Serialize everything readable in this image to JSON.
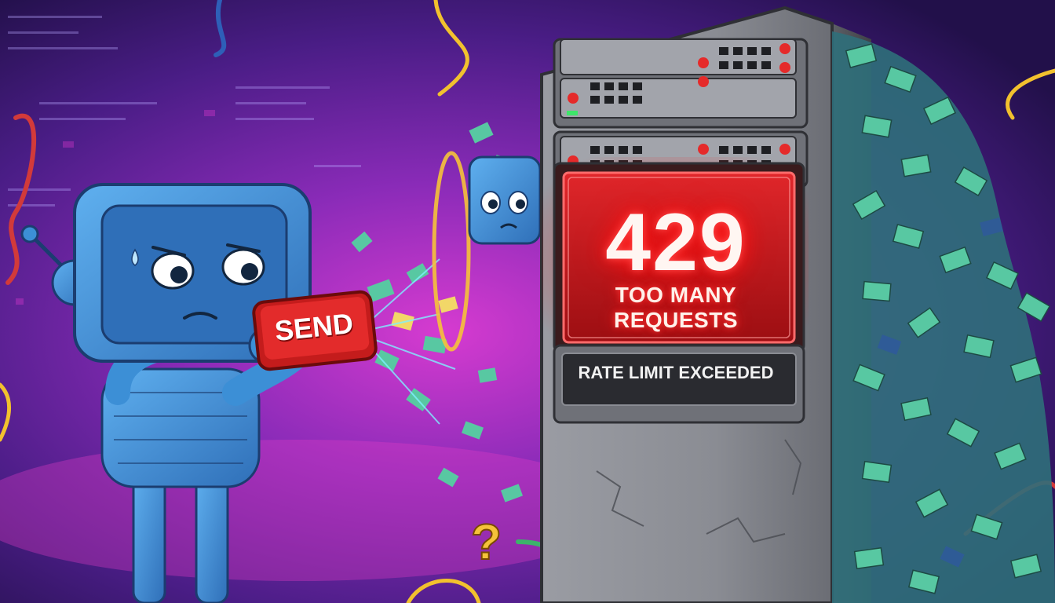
{
  "illustration": {
    "send_button_label": "SEND",
    "status_code": "429",
    "status_text": "TOO MANY REQUESTS",
    "status_detail": "RATE LIMIT EXCEEDED"
  },
  "colors": {
    "bg_purple": "#3a1a78",
    "bg_magenta": "#c21fae",
    "robot_blue": "#3c8fd6",
    "server_gray": "#8b8e96",
    "error_red": "#e01f25",
    "paper_green": "#58c8a2",
    "cable_yellow": "#f2c12e"
  },
  "icons": [
    "robot-icon",
    "server-rack-icon",
    "question-mark-icon",
    "cable-icon",
    "envelope-icon"
  ]
}
